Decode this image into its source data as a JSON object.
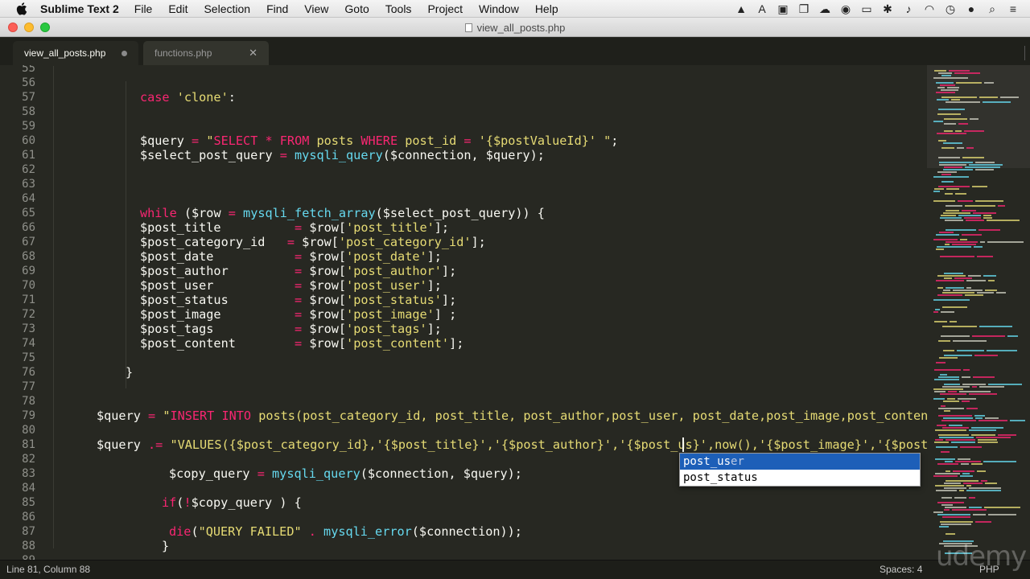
{
  "menubar": {
    "app_name": "Sublime Text 2",
    "menus": [
      "File",
      "Edit",
      "Selection",
      "Find",
      "View",
      "Goto",
      "Tools",
      "Project",
      "Window",
      "Help"
    ]
  },
  "window": {
    "title": "view_all_posts.php"
  },
  "tabs": [
    {
      "label": "view_all_posts.php",
      "active": true,
      "modified": true
    },
    {
      "label": "functions.php",
      "active": false,
      "modified": false
    }
  ],
  "editor": {
    "first_line": 55,
    "lines": [
      {
        "n": "55",
        "indent": 0,
        "tokens": []
      },
      {
        "n": "56",
        "indent": 0,
        "tokens": []
      },
      {
        "n": "57",
        "indent": 12,
        "tokens": [
          {
            "t": "case ",
            "c": "kw"
          },
          {
            "t": "'clone'",
            "c": "str"
          },
          {
            "t": ":",
            "c": "pl"
          }
        ]
      },
      {
        "n": "58",
        "indent": 0,
        "tokens": []
      },
      {
        "n": "59",
        "indent": 0,
        "tokens": []
      },
      {
        "n": "60",
        "indent": 12,
        "tokens": [
          {
            "t": "$query ",
            "c": "pl"
          },
          {
            "t": "= ",
            "c": "kw"
          },
          {
            "t": "\"",
            "c": "str"
          },
          {
            "t": "SELECT ",
            "c": "kw"
          },
          {
            "t": "* ",
            "c": "kw"
          },
          {
            "t": "FROM ",
            "c": "kw"
          },
          {
            "t": "posts ",
            "c": "str"
          },
          {
            "t": "WHERE ",
            "c": "kw"
          },
          {
            "t": "post_id ",
            "c": "str"
          },
          {
            "t": "= ",
            "c": "kw"
          },
          {
            "t": "'{$postValueId}' \"",
            "c": "str"
          },
          {
            "t": ";",
            "c": "pl"
          }
        ]
      },
      {
        "n": "61",
        "indent": 12,
        "tokens": [
          {
            "t": "$select_post_query ",
            "c": "pl"
          },
          {
            "t": "= ",
            "c": "kw"
          },
          {
            "t": "mysqli_query",
            "c": "fn"
          },
          {
            "t": "($connection, $query);",
            "c": "pl"
          }
        ]
      },
      {
        "n": "62",
        "indent": 0,
        "tokens": []
      },
      {
        "n": "63",
        "indent": 0,
        "tokens": []
      },
      {
        "n": "64",
        "indent": 0,
        "tokens": []
      },
      {
        "n": "65",
        "indent": 12,
        "tokens": [
          {
            "t": "while ",
            "c": "kw"
          },
          {
            "t": "($row ",
            "c": "pl"
          },
          {
            "t": "= ",
            "c": "kw"
          },
          {
            "t": "mysqli_fetch_array",
            "c": "fn"
          },
          {
            "t": "($select_post_query)) {",
            "c": "pl"
          }
        ]
      },
      {
        "n": "66",
        "indent": 12,
        "tokens": [
          {
            "t": "$post_title          ",
            "c": "pl"
          },
          {
            "t": "= ",
            "c": "kw"
          },
          {
            "t": "$row[",
            "c": "pl"
          },
          {
            "t": "'post_title'",
            "c": "str"
          },
          {
            "t": "];",
            "c": "pl"
          }
        ]
      },
      {
        "n": "67",
        "indent": 12,
        "tokens": [
          {
            "t": "$post_category_id   ",
            "c": "pl"
          },
          {
            "t": "= ",
            "c": "kw"
          },
          {
            "t": "$row[",
            "c": "pl"
          },
          {
            "t": "'post_category_id'",
            "c": "str"
          },
          {
            "t": "];",
            "c": "pl"
          }
        ]
      },
      {
        "n": "68",
        "indent": 12,
        "tokens": [
          {
            "t": "$post_date           ",
            "c": "pl"
          },
          {
            "t": "= ",
            "c": "kw"
          },
          {
            "t": "$row[",
            "c": "pl"
          },
          {
            "t": "'post_date'",
            "c": "str"
          },
          {
            "t": "];",
            "c": "pl"
          }
        ]
      },
      {
        "n": "69",
        "indent": 12,
        "tokens": [
          {
            "t": "$post_author         ",
            "c": "pl"
          },
          {
            "t": "= ",
            "c": "kw"
          },
          {
            "t": "$row[",
            "c": "pl"
          },
          {
            "t": "'post_author'",
            "c": "str"
          },
          {
            "t": "];",
            "c": "pl"
          }
        ]
      },
      {
        "n": "70",
        "indent": 12,
        "tokens": [
          {
            "t": "$post_user           ",
            "c": "pl"
          },
          {
            "t": "= ",
            "c": "kw"
          },
          {
            "t": "$row[",
            "c": "pl"
          },
          {
            "t": "'post_user'",
            "c": "str"
          },
          {
            "t": "];",
            "c": "pl"
          }
        ]
      },
      {
        "n": "71",
        "indent": 12,
        "tokens": [
          {
            "t": "$post_status         ",
            "c": "pl"
          },
          {
            "t": "= ",
            "c": "kw"
          },
          {
            "t": "$row[",
            "c": "pl"
          },
          {
            "t": "'post_status'",
            "c": "str"
          },
          {
            "t": "];",
            "c": "pl"
          }
        ]
      },
      {
        "n": "72",
        "indent": 12,
        "tokens": [
          {
            "t": "$post_image          ",
            "c": "pl"
          },
          {
            "t": "= ",
            "c": "kw"
          },
          {
            "t": "$row[",
            "c": "pl"
          },
          {
            "t": "'post_image'",
            "c": "str"
          },
          {
            "t": "] ;",
            "c": "pl"
          }
        ]
      },
      {
        "n": "73",
        "indent": 12,
        "tokens": [
          {
            "t": "$post_tags           ",
            "c": "pl"
          },
          {
            "t": "= ",
            "c": "kw"
          },
          {
            "t": "$row[",
            "c": "pl"
          },
          {
            "t": "'post_tags'",
            "c": "str"
          },
          {
            "t": "];",
            "c": "pl"
          }
        ]
      },
      {
        "n": "74",
        "indent": 12,
        "tokens": [
          {
            "t": "$post_content        ",
            "c": "pl"
          },
          {
            "t": "= ",
            "c": "kw"
          },
          {
            "t": "$row[",
            "c": "pl"
          },
          {
            "t": "'post_content'",
            "c": "str"
          },
          {
            "t": "];",
            "c": "pl"
          }
        ]
      },
      {
        "n": "75",
        "indent": 0,
        "tokens": []
      },
      {
        "n": "76",
        "indent": 10,
        "tokens": [
          {
            "t": "}",
            "c": "pl"
          }
        ]
      },
      {
        "n": "77",
        "indent": 0,
        "tokens": []
      },
      {
        "n": "78",
        "indent": 0,
        "tokens": []
      },
      {
        "n": "79",
        "indent": 6,
        "tokens": [
          {
            "t": "$query ",
            "c": "pl"
          },
          {
            "t": "= ",
            "c": "kw"
          },
          {
            "t": "\"",
            "c": "str"
          },
          {
            "t": "INSERT ",
            "c": "kw"
          },
          {
            "t": "INTO ",
            "c": "kw"
          },
          {
            "t": "posts(post_category_id, post_title, post_author,post_user, post_date,post_image,post_content,post_tags",
            "c": "str"
          }
        ]
      },
      {
        "n": "80",
        "indent": 0,
        "tokens": []
      },
      {
        "n": "81",
        "indent": 6,
        "tokens": [
          {
            "t": "$query ",
            "c": "pl"
          },
          {
            "t": ".= ",
            "c": "kw"
          },
          {
            "t": "\"VALUES({$post_category_id},'{$post_title}','{$post_author}','{$post_us}',now(),'{$post_image}','{$post_content}'",
            "c": "str"
          }
        ]
      },
      {
        "n": "82",
        "indent": 0,
        "tokens": []
      },
      {
        "n": "83",
        "indent": 16,
        "tokens": [
          {
            "t": "$copy_query ",
            "c": "pl"
          },
          {
            "t": "= ",
            "c": "kw"
          },
          {
            "t": "mysqli_query",
            "c": "fn"
          },
          {
            "t": "($connection, $query);",
            "c": "pl"
          }
        ]
      },
      {
        "n": "84",
        "indent": 0,
        "tokens": []
      },
      {
        "n": "85",
        "indent": 15,
        "tokens": [
          {
            "t": "if",
            "c": "kw"
          },
          {
            "t": "(",
            "c": "pl"
          },
          {
            "t": "!",
            "c": "kw"
          },
          {
            "t": "$copy_query ) {",
            "c": "pl"
          }
        ]
      },
      {
        "n": "86",
        "indent": 0,
        "tokens": []
      },
      {
        "n": "87",
        "indent": 16,
        "tokens": [
          {
            "t": "die",
            "c": "kw"
          },
          {
            "t": "(",
            "c": "pl"
          },
          {
            "t": "\"QUERY FAILED\" ",
            "c": "str"
          },
          {
            "t": ". ",
            "c": "kw"
          },
          {
            "t": "mysqli_error",
            "c": "fn"
          },
          {
            "t": "($connection));",
            "c": "pl"
          }
        ]
      },
      {
        "n": "88",
        "indent": 15,
        "tokens": [
          {
            "t": "}",
            "c": "pl"
          }
        ]
      },
      {
        "n": "89",
        "indent": 0,
        "tokens": []
      }
    ]
  },
  "autocomplete": {
    "items": [
      {
        "typed": "post_us",
        "rest": "er"
      },
      {
        "typed": "post_stat",
        "rest": "us"
      }
    ]
  },
  "statusbar": {
    "position": "Line 81, Column 88",
    "indentation": "Spaces: 4",
    "syntax": "PHP"
  },
  "watermark": "udemy",
  "colors": {
    "background": "#272822",
    "keyword": "#f92672",
    "string": "#e6db74",
    "function": "#66d9ef",
    "text": "#f8f8f2",
    "autocomplete_selection": "#1d5fb8"
  }
}
